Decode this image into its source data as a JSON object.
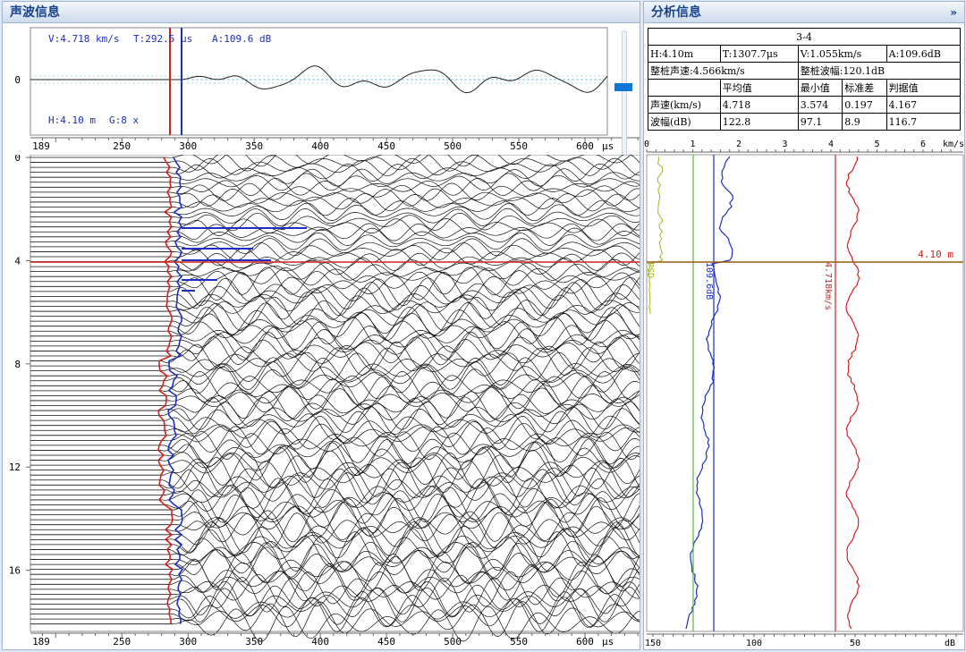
{
  "colors": {
    "red": "#d42020",
    "blue": "#1c2fc0",
    "green": "#55b83d",
    "olive": "#a6b91e",
    "brown": "#9a5a12",
    "accent_blue": "#0a78d4",
    "title_text": "#15428b"
  },
  "left_panel": {
    "title": "声波信息",
    "wave_info": {
      "velocity": "V:4.718 km/s",
      "time": "T:292.5 μs",
      "amplitude": "A:109.6 dB",
      "height": "H:4.10 m",
      "gain": "G:8 x",
      "zero_label": "0"
    },
    "time_axis": {
      "ticks": [
        "189",
        "250",
        "300",
        "350",
        "400",
        "450",
        "500",
        "550",
        "600"
      ],
      "unit": "μs"
    },
    "depth_axis": {
      "ticks": [
        "0",
        "4",
        "8",
        "12",
        "16"
      ]
    }
  },
  "right_panel": {
    "title": "分析信息",
    "collapse_icon": "double-chevron-right-icon",
    "section": "3-4",
    "row1": {
      "h": "H:4.10m",
      "t": "T:1307.7μs",
      "v": "V:1.055km/s",
      "a": "A:109.6dB"
    },
    "row2": {
      "pile_velocity": "整桩声速:4.566km/s",
      "pile_amplitude": "整桩波幅:120.1dB"
    },
    "stats_headers": [
      "",
      "平均值",
      "最小值",
      "标准差",
      "判据值"
    ],
    "stats_rows": [
      [
        "声速(km/s)",
        "4.718",
        "3.574",
        "0.197",
        "4.167"
      ],
      [
        "波幅(dB)",
        "122.8",
        "97.1",
        "8.9",
        "116.7"
      ]
    ],
    "velocity_axis": {
      "ticks": [
        "0",
        "1",
        "2",
        "3",
        "4",
        "5",
        "6"
      ],
      "unit": "km/s"
    },
    "db_axis": {
      "ticks": [
        "150",
        "100",
        "50"
      ],
      "unit": "dB"
    },
    "depth_marker": "4.10 m",
    "amp_line_label": "109.6dB",
    "vel_line_label": "4.718km/s",
    "psd_label": "PSD"
  }
}
